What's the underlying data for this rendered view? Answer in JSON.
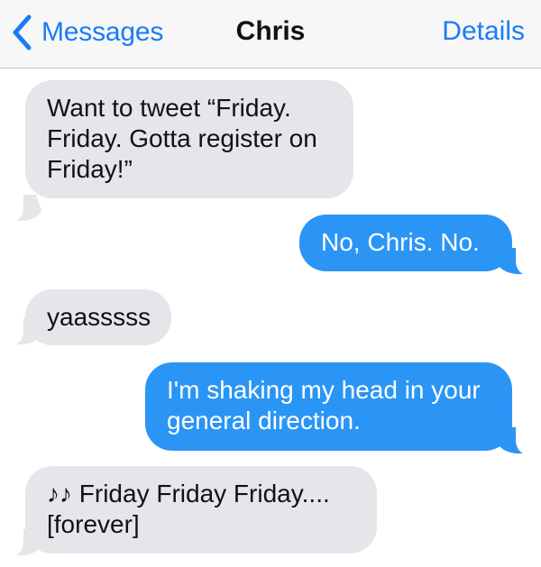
{
  "navbar": {
    "back_label": "Messages",
    "contact_name": "Chris",
    "details_label": "Details",
    "accent_color": "#1a7cf5"
  },
  "messages": [
    {
      "direction": "incoming",
      "text": "Want to tweet “Friday.\nFriday. Gotta register on\nFriday!”"
    },
    {
      "direction": "outgoing",
      "text": "No, Chris. No."
    },
    {
      "direction": "incoming",
      "text": "yaasssss"
    },
    {
      "direction": "outgoing",
      "text": "I'm shaking my head in your\ngeneral direction."
    },
    {
      "direction": "incoming",
      "text": "♪♪ Friday Friday Friday....\n[forever]"
    }
  ],
  "colors": {
    "incoming_bubble": "#e5e5ea",
    "outgoing_bubble": "#2b95f5"
  }
}
